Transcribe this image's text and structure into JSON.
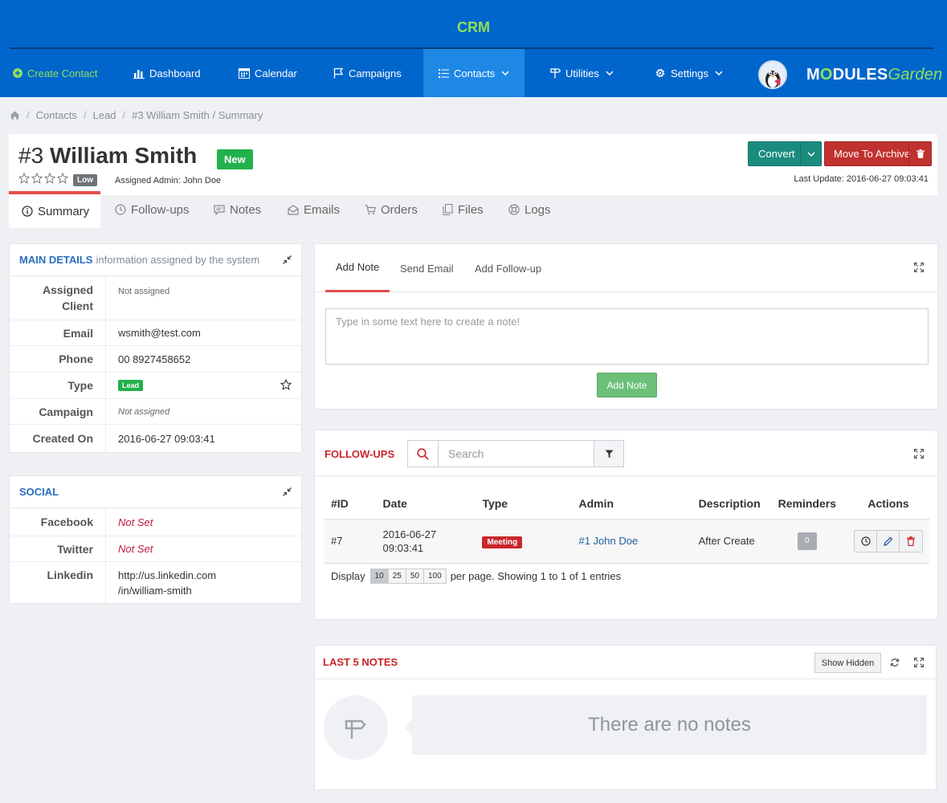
{
  "app": {
    "title": "CRM"
  },
  "nav": {
    "create_contact": "Create Contact",
    "dashboard": "Dashboard",
    "calendar": "Calendar",
    "campaigns": "Campaigns",
    "contacts": "Contacts",
    "utilities": "Utilities",
    "settings": "Settings"
  },
  "logo": {
    "part1": "M",
    "o": "O",
    "part2": "DULES",
    "garden": "Garden"
  },
  "breadcrumb": {
    "contacts": "Contacts",
    "lead": "Lead",
    "current": "#3 William Smith / Summary"
  },
  "contact": {
    "id": "#3",
    "name": "William Smith",
    "status": "New",
    "priority": "Low",
    "rating": 0,
    "assigned_admin": "Assigned Admin: John Doe",
    "last_update": "Last Update: 2016-06-27 09:03:41"
  },
  "actions": {
    "convert": "Convert",
    "archive": "Move To Archive"
  },
  "tabs": [
    "Summary",
    "Follow-ups",
    "Notes",
    "Emails",
    "Orders",
    "Files",
    "Logs"
  ],
  "main_details": {
    "title": "MAIN DETAILS",
    "subtitle": "information assigned by the system",
    "rows": {
      "client_label": "Assigned Client",
      "client_value": "Not assigned",
      "email_label": "Email",
      "email_value": "wsmith@test.com",
      "phone_label": "Phone",
      "phone_value": "00 8927458652",
      "type_label": "Type",
      "type_value": "Lead",
      "campaign_label": "Campaign",
      "campaign_value": "Not assigned",
      "created_label": "Created On",
      "created_value": "2016-06-27 09:03:41"
    }
  },
  "social": {
    "title": "SOCIAL",
    "facebook_label": "Facebook",
    "facebook_value": "Not Set",
    "twitter_label": "Twitter",
    "twitter_value": "Not Set",
    "linkedin_label": "Linkedin",
    "linkedin_line1": "http://us.linkedin.com",
    "linkedin_line2": "/in/william-smith"
  },
  "composer": {
    "tabs": [
      "Add Note",
      "Send Email",
      "Add Follow-up"
    ],
    "placeholder": "Type in some text here to create a note!",
    "submit": "Add Note"
  },
  "followups": {
    "title": "FOLLOW-UPS",
    "search_placeholder": "Search",
    "columns": [
      "#ID",
      "Date",
      "Type",
      "Admin",
      "Description",
      "Reminders",
      "Actions"
    ],
    "rows": [
      {
        "id": "#7",
        "date_line1": "2016-06-27",
        "date_line2": "09:03:41",
        "type": "Meeting",
        "admin": "#1 John Doe",
        "description": "After Create",
        "reminders": "0"
      }
    ],
    "pager": {
      "display": "Display",
      "sizes": [
        "10",
        "25",
        "50",
        "100"
      ],
      "selected": "10",
      "suffix": "per page. Showing 1 to 1 of 1 entries"
    }
  },
  "notes": {
    "title": "LAST 5 NOTES",
    "show_hidden": "Show Hidden",
    "empty": "There are no notes"
  },
  "colors": {
    "header": "#0066cc",
    "accent_green": "#8fe05a",
    "status_green": "#22b14c",
    "danger": "#c0322f",
    "convert": "#1a8c7e"
  }
}
